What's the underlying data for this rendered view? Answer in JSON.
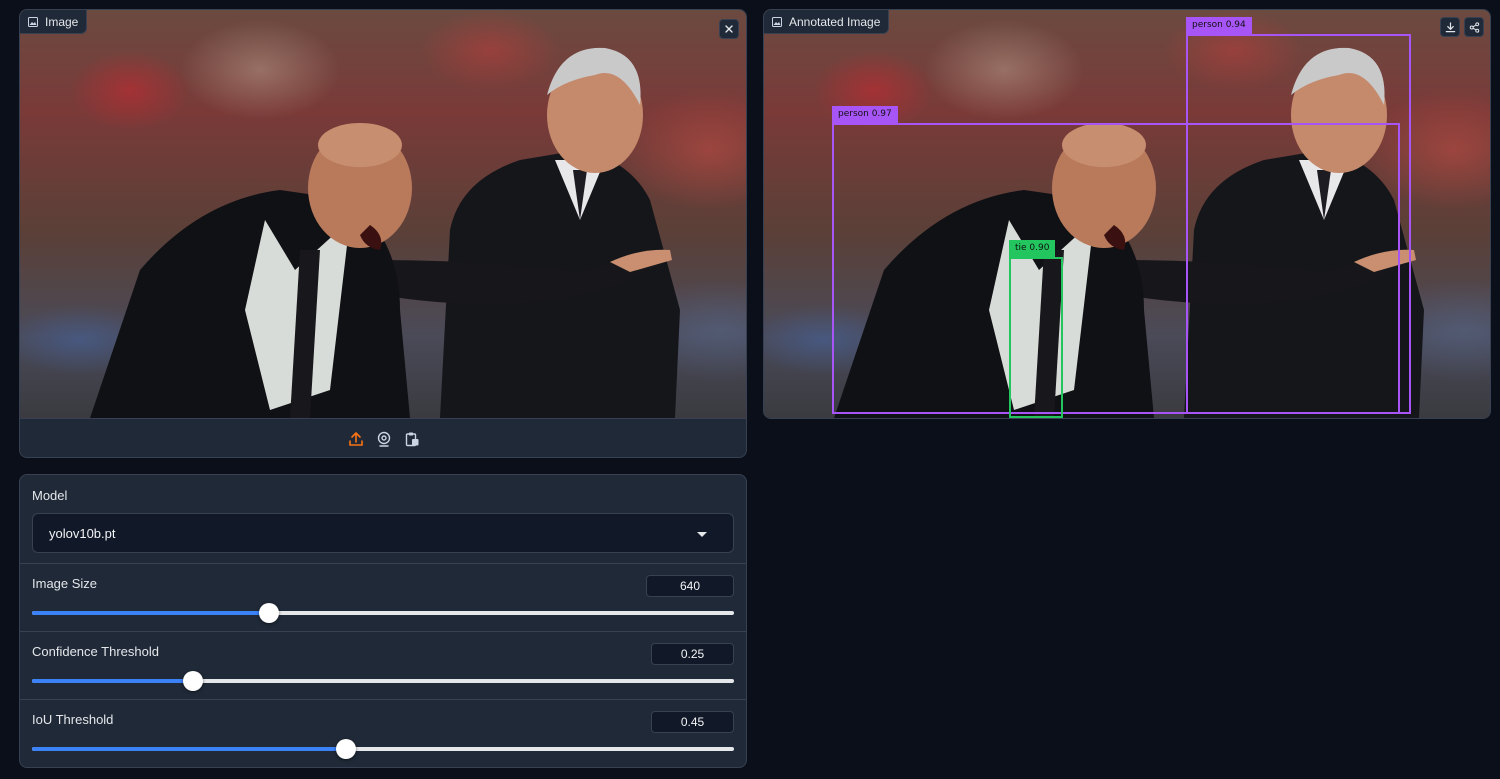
{
  "input_image": {
    "label": "Image",
    "icons": {
      "label": "image-icon",
      "clear": "close-icon",
      "sources": [
        "upload-icon",
        "webcam-icon",
        "clipboard-icon"
      ]
    }
  },
  "output_image": {
    "label": "Annotated Image",
    "icons": {
      "label": "image-icon",
      "download": "download-icon",
      "share": "share-icon"
    },
    "detections": [
      {
        "label": "person  0.97",
        "class": "person",
        "confidence": 0.97,
        "color": "#a855f7"
      },
      {
        "label": "person  0.94",
        "class": "person",
        "confidence": 0.94,
        "color": "#a855f7"
      },
      {
        "label": "tie  0.90",
        "class": "tie",
        "confidence": 0.9,
        "color": "#22c55e"
      }
    ]
  },
  "settings": {
    "model": {
      "label": "Model",
      "value": "yolov10b.pt"
    },
    "image_size": {
      "label": "Image Size",
      "value": "640",
      "fraction": 0.337
    },
    "confidence": {
      "label": "Confidence Threshold",
      "value": "0.25",
      "fraction": 0.229
    },
    "iou": {
      "label": "IoU Threshold",
      "value": "0.45",
      "fraction": 0.447
    }
  },
  "colors": {
    "background": "#0b0f19",
    "panel": "#1f2937",
    "border": "#374151",
    "accent": "#3b82f6",
    "upload_accent": "#f97316"
  }
}
